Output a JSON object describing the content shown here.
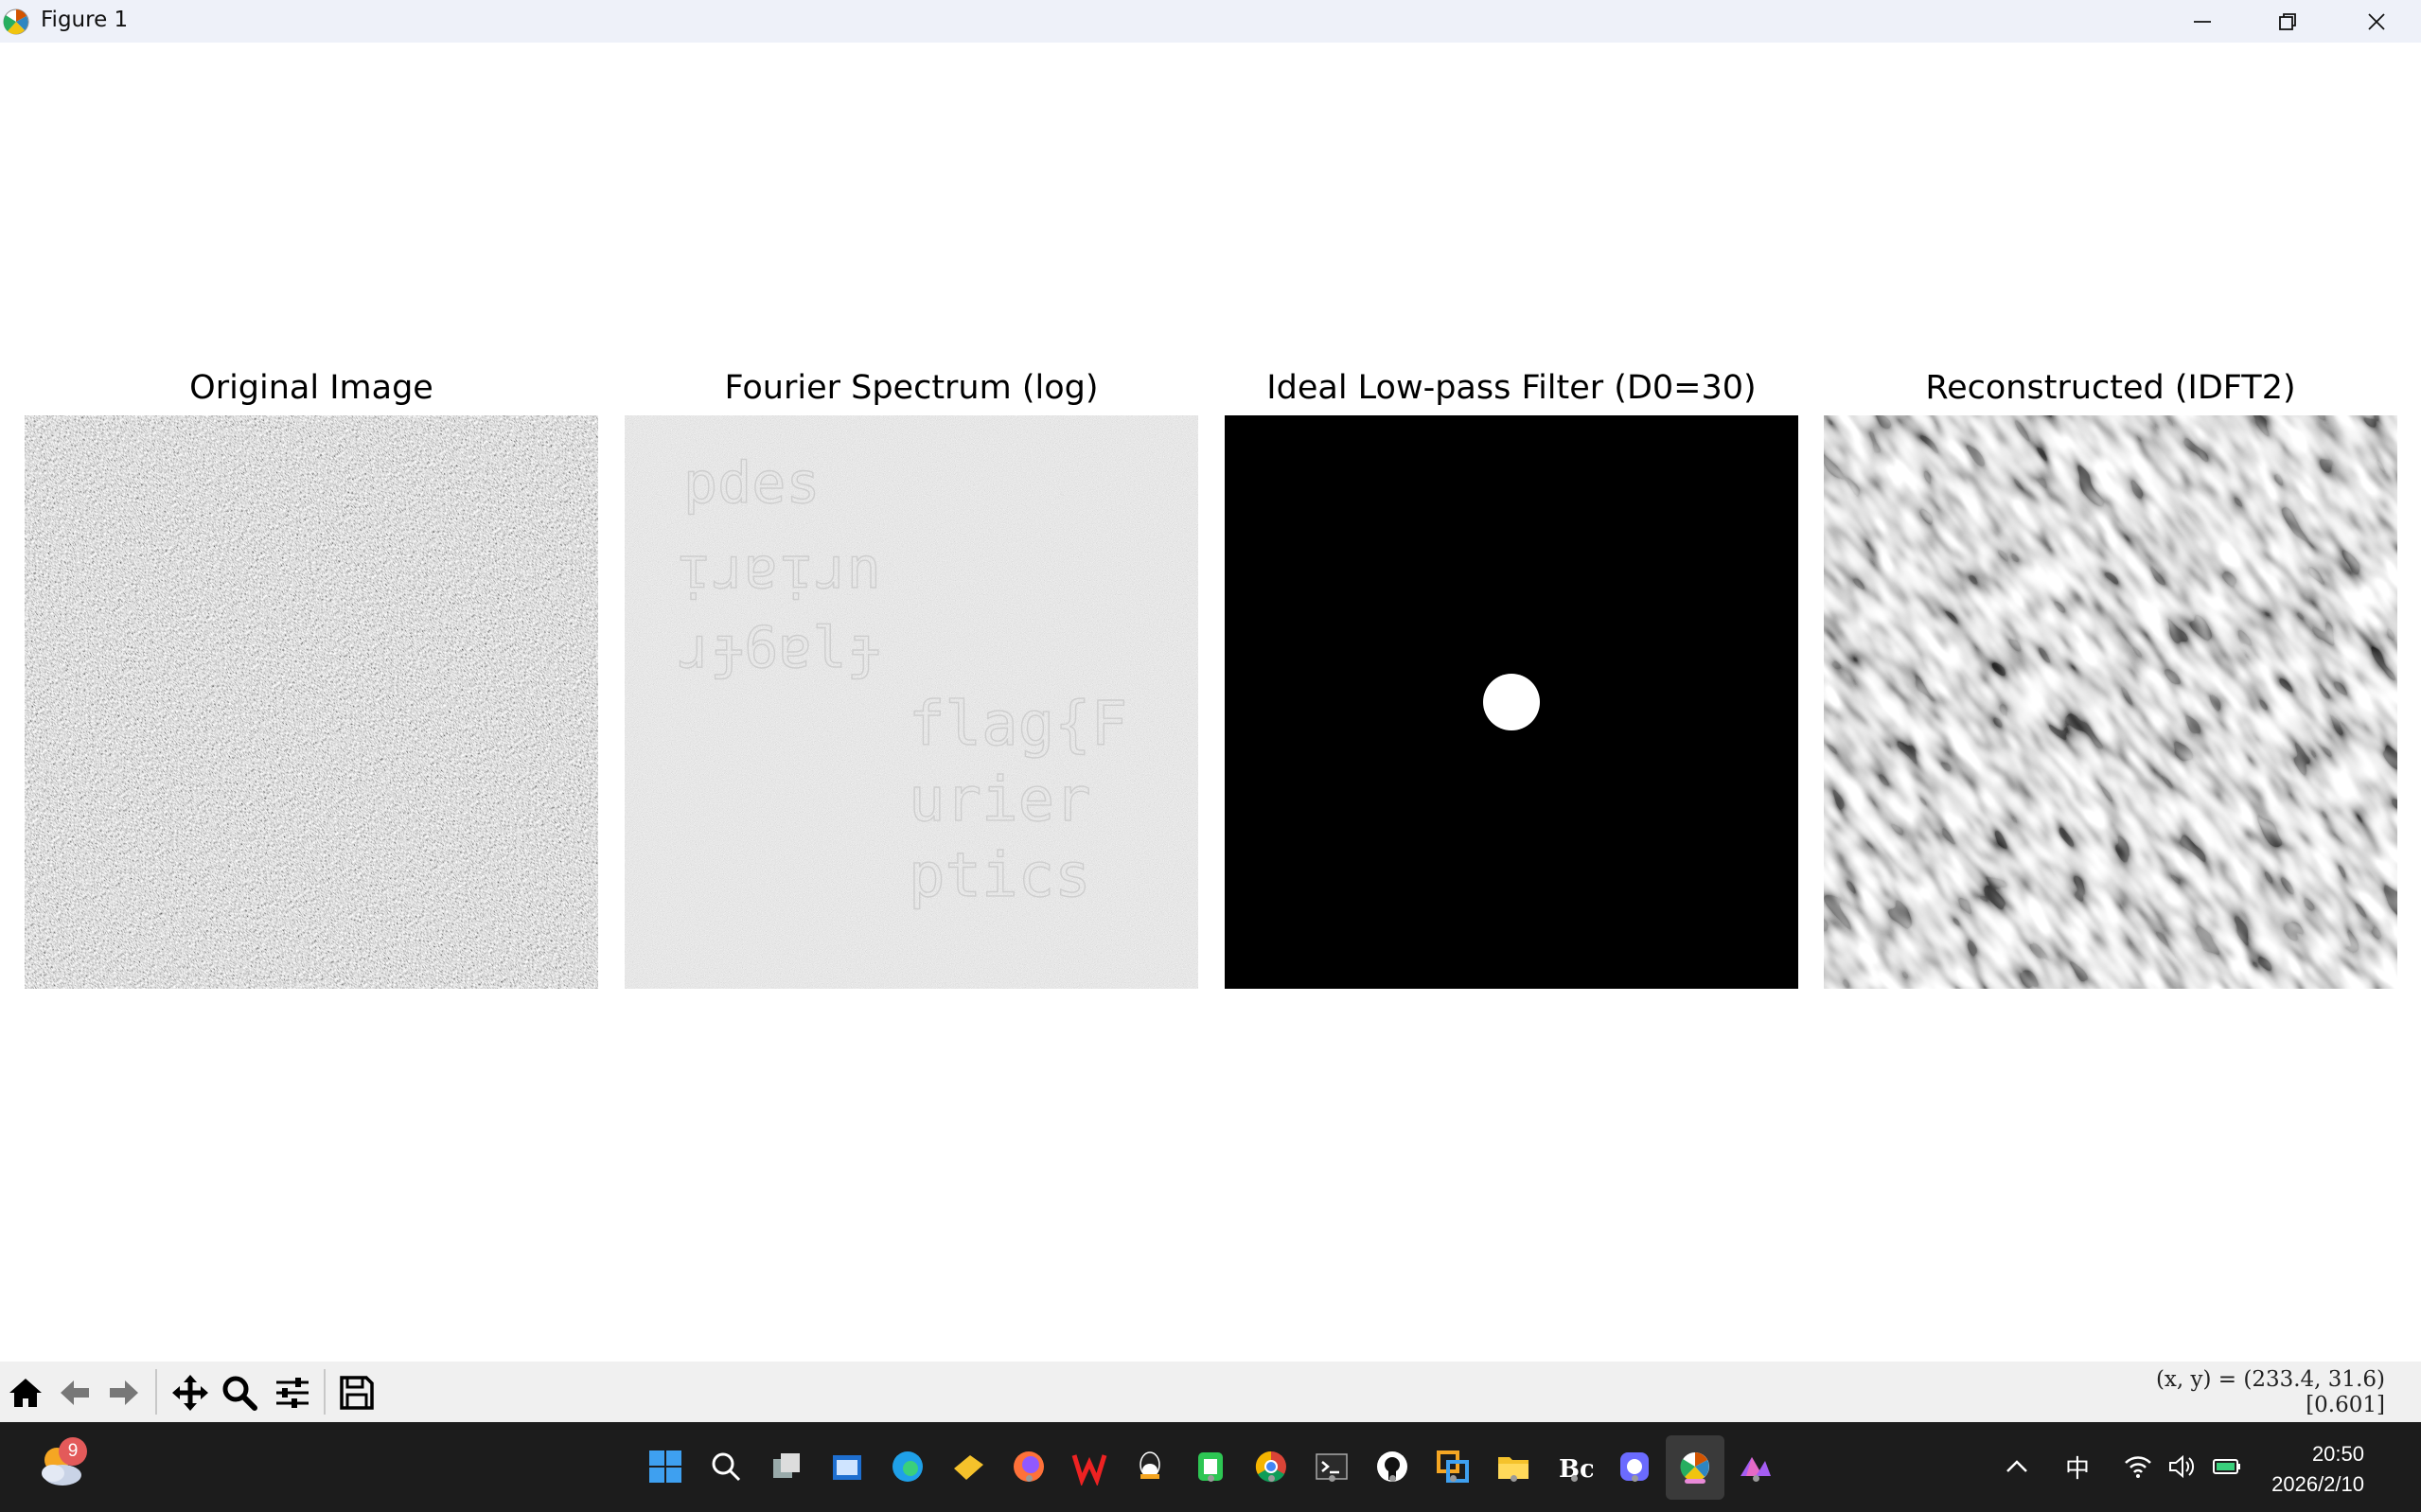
{
  "window": {
    "title": "Figure 1",
    "controls": [
      "minimize-icon",
      "restore-icon",
      "close-icon"
    ]
  },
  "figure": {
    "panels": [
      {
        "title": "Original Image",
        "kind": "noise-texture"
      },
      {
        "title": "Fourier Spectrum (log)",
        "kind": "gray-noise-with-faint-text"
      },
      {
        "title": "Ideal Low-pass Filter (D0=30)",
        "kind": "black-with-white-disc"
      },
      {
        "title": "Reconstructed (IDFT2)",
        "kind": "smooth-blob-texture"
      }
    ],
    "spectrum_faint_text": [
      "flag{F",
      "urier",
      "ptics",
      "pdes",
      "ᴉɹɐᴉɹn",
      "ɹɟ6ɐlɟ"
    ]
  },
  "toolbar": {
    "buttons": [
      "home-icon",
      "back-icon",
      "forward-icon",
      "pan-icon",
      "zoom-icon",
      "configure-subplots-icon",
      "save-icon"
    ],
    "coord_line1": "(x, y) = (233.4, 31.6)",
    "coord_line2": "[0.601]"
  },
  "taskbar": {
    "weather_badge": "9",
    "apps": [
      "windows-start-icon",
      "search-icon",
      "task-view-icon",
      "store-icon",
      "edge-icon",
      "notes-icon",
      "firefox-icon",
      "wps-icon",
      "qq-icon",
      "phone-icon",
      "chrome-icon",
      "terminal-icon",
      "github-icon",
      "remote-icon",
      "file-explorer-icon",
      "bc-icon",
      "app-icon",
      "matplotlib-icon",
      "matlab-icon"
    ],
    "ime": "中",
    "time": "20:50",
    "date": "2026/2/10"
  }
}
